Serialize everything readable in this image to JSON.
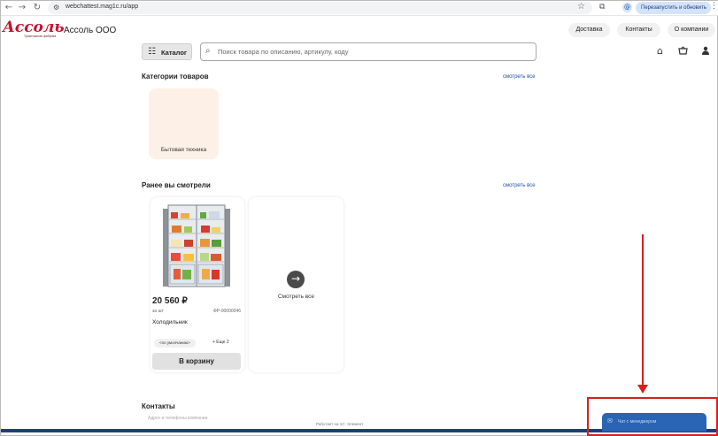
{
  "browser": {
    "url": "webchattest.mag1c.ru/app",
    "relaunch_label": "Перезапустить и обновить",
    "profile_initial": "@"
  },
  "site": {
    "logo_text": "Ассоль",
    "logo_subtext": "Трикотажная фабрика",
    "company_name": "Ассоль ООО",
    "nav": [
      "Доставка",
      "Контакты",
      "О компании"
    ]
  },
  "toolbar": {
    "catalog_label": "Каталог",
    "search_placeholder": "Поиск товара по описанию, артикулу, коду"
  },
  "categories": {
    "title": "Категории товаров",
    "see_all": "смотреть все",
    "items": [
      {
        "label": "Бытовая техника"
      }
    ]
  },
  "recent": {
    "title": "Ранее вы смотрели",
    "see_all": "смотреть все",
    "product": {
      "price": "20 560 ₽",
      "unit": "за шт",
      "sku": "ФР-00000046",
      "name": "Холодильник",
      "variant": "<по умолчанию>",
      "more": "+ Еще 2",
      "cart_label": "В корзину"
    },
    "view_all_label": "Смотреть все"
  },
  "contacts": {
    "title": "Контакты",
    "subtitle": "Адрес и телефоны компании"
  },
  "footer": {
    "text": "Работает на 1С: Элемент"
  },
  "chat": {
    "label": "Чат с менеджером"
  },
  "colors": {
    "accent": "#1f4fa0",
    "brand_red": "#c8102e",
    "annotation": "#d81e1e",
    "chat": "#2a64b5"
  }
}
